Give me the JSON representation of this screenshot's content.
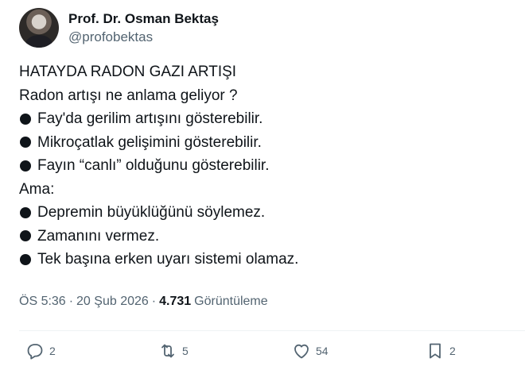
{
  "author": {
    "display_name": "Prof. Dr. Osman Bektaş",
    "handle": "@profobektas"
  },
  "tweet": {
    "lines": [
      "HATAYDA RADON GAZI ARTIŞI",
      "Radon artışı ne anlama geliyor ?",
      "Fay'da gerilim artışını gösterebilir.",
      "Mikroçatlak gelişimini gösterebilir.",
      "Fayın “canlı” olduğunu gösterebilir.",
      "Ama:",
      "Depremin büyüklüğünü söylemez.",
      "Zamanını vermez.",
      "Tek başına erken uyarı sistemi olamaz."
    ]
  },
  "meta": {
    "time": "ÖS 5:36",
    "separator": "·",
    "date": "20 Şub 2026",
    "views_count": "4.731",
    "views_label": "Görüntüleme"
  },
  "actions": {
    "reply": {
      "icon": "reply-icon",
      "count": "2"
    },
    "retweet": {
      "icon": "retweet-icon",
      "count": "5"
    },
    "like": {
      "icon": "heart-icon",
      "count": "54"
    },
    "bookmark": {
      "icon": "bookmark-icon",
      "count": "2"
    }
  },
  "colors": {
    "text": "#0f1419",
    "secondary": "#536471",
    "divider": "#eff3f4"
  }
}
